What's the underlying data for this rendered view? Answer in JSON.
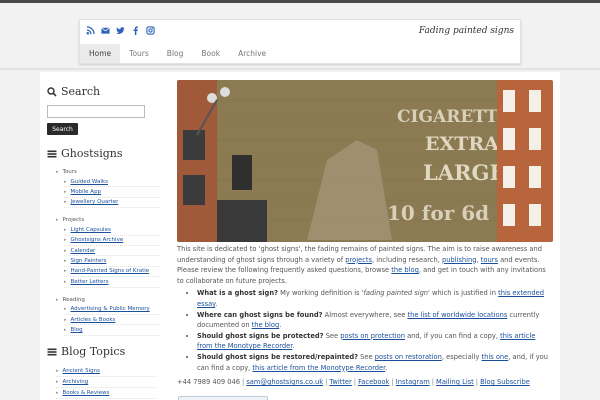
{
  "header": {
    "tagline": "Fading painted signs",
    "social_icons": [
      "rss-icon",
      "email-icon",
      "twitter-icon",
      "facebook-icon",
      "instagram-icon"
    ],
    "nav": [
      "Home",
      "Tours",
      "Blog",
      "Book",
      "Archive"
    ],
    "active_nav": "Home"
  },
  "sidebar": {
    "search_title": "Search",
    "search_placeholder": "",
    "search_button": "Search",
    "ghostsigns_title": "Ghostsigns",
    "categories": [
      {
        "label": "Tours",
        "items": [
          "Guided Walks",
          "Mobile App",
          "Jewellery Quarter"
        ]
      },
      {
        "label": "Projects",
        "items": [
          "Light Capsules",
          "Ghostsigns Archive",
          "Calendar",
          "Sign Painters",
          "Hand-Painted Signs of Kratie",
          "Better Letters"
        ]
      },
      {
        "label": "Reading",
        "items": [
          "Advertising & Public Memory",
          "Articles & Books",
          "Blog"
        ]
      }
    ],
    "topics_title": "Blog Topics",
    "topics": [
      "Ancient Signs",
      "Archiving",
      "Books & Reviews"
    ]
  },
  "content": {
    "intro": [
      {
        "t": "This site is dedicated to 'ghost signs', the fading remains of painted signs. The aim is to raise awareness and understanding of ghost signs through a variety of "
      },
      {
        "t": "projects",
        "link": true
      },
      {
        "t": ", including research, "
      },
      {
        "t": "publishing",
        "link": true
      },
      {
        "t": ", "
      },
      {
        "t": "tours",
        "link": true
      },
      {
        "t": " and events. Please review the following frequently asked questions, browse "
      },
      {
        "t": "the blog",
        "link": true
      },
      {
        "t": ", and get in touch with any invitations to collaborate on future projects."
      }
    ],
    "faq": [
      [
        {
          "t": "What is a ghost sign?",
          "bold": true
        },
        {
          "t": " My working definition is "
        },
        {
          "t": "'fading painted sign'",
          "italic": true
        },
        {
          "t": " which is justified in "
        },
        {
          "t": "this extended essay",
          "link": true
        },
        {
          "t": "."
        }
      ],
      [
        {
          "t": "Where can ghost signs be found?",
          "bold": true
        },
        {
          "t": " Almost everywhere, see "
        },
        {
          "t": "the list of worldwide locations",
          "link": true
        },
        {
          "t": " currently documented on "
        },
        {
          "t": "the blog",
          "link": true
        },
        {
          "t": "."
        }
      ],
      [
        {
          "t": "Should ghost signs be protected?",
          "bold": true
        },
        {
          "t": " See "
        },
        {
          "t": "posts on protection",
          "link": true
        },
        {
          "t": " and, if you can find a copy, "
        },
        {
          "t": "this article from the Monotype Recorder",
          "link": true
        },
        {
          "t": "."
        }
      ],
      [
        {
          "t": "Should ghost signs be restored/repainted?",
          "bold": true
        },
        {
          "t": " See "
        },
        {
          "t": "posts on restoration",
          "link": true
        },
        {
          "t": ", especially "
        },
        {
          "t": "this one",
          "link": true
        },
        {
          "t": ", and, if you can find a copy, "
        },
        {
          "t": "this article from the Monotype Recorder",
          "link": true
        },
        {
          "t": "."
        }
      ]
    ],
    "contact": [
      {
        "t": "+44 7989 409 046"
      },
      {
        "t": "sam@ghostsigns.co.uk",
        "link": true
      },
      {
        "t": "Twitter",
        "link": true
      },
      {
        "t": "Facebook",
        "link": true
      },
      {
        "t": "Instagram",
        "link": true
      },
      {
        "t": "Mailing List",
        "link": true
      },
      {
        "t": "Blog Subscribe",
        "link": true
      }
    ],
    "hero_sign_text": [
      "CIGARETTES",
      "EXTRA",
      "LARGE",
      "10 for 6d"
    ]
  },
  "colors": {
    "link": "#1a4f9c",
    "icon": "#2d63b8",
    "button": "#2a2a2a"
  }
}
